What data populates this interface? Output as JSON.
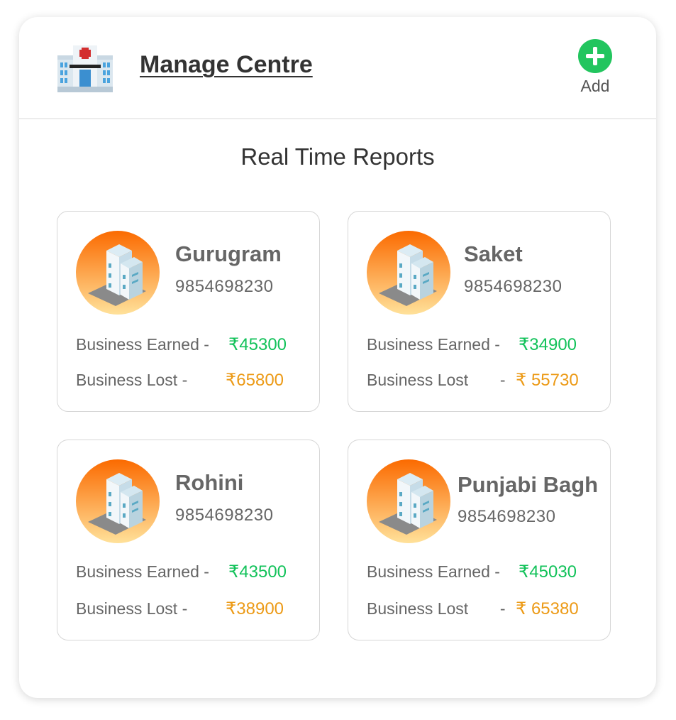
{
  "header": {
    "title": "Manage Centre",
    "add_label": "Add",
    "hospital_icon": "hospital-icon",
    "add_icon": "plus-circle-icon"
  },
  "section": {
    "title": "Real Time Reports"
  },
  "centres": [
    {
      "name": "Gurugram",
      "phone": "9854698230",
      "earned_label": "Business Earned -",
      "earned": "₹45300",
      "lost_label": "Business Lost -",
      "lost": "₹65800"
    },
    {
      "name": "Saket",
      "phone": "9854698230",
      "earned_label": "Business Earned -",
      "earned": "₹34900",
      "lost_label": "Business Lost       -",
      "lost": "₹ 55730"
    },
    {
      "name": "Rohini",
      "phone": "9854698230",
      "earned_label": "Business Earned -",
      "earned": "₹43500",
      "lost_label": "Business Lost -",
      "lost": "₹38900"
    },
    {
      "name": "Punjabi Bagh",
      "phone": "9854698230",
      "earned_label": "Business Earned -",
      "earned": "₹45030",
      "lost_label": "Business Lost       -",
      "lost": "₹ 65380"
    }
  ],
  "colors": {
    "earned": "#12c25a",
    "lost": "#ec9a16",
    "add_button": "#22c55e",
    "avatar_gradient_top": "#fb6a00",
    "avatar_gradient_bottom": "#ffe19a"
  },
  "icons": {
    "centre_avatar": "office-building-icon"
  }
}
